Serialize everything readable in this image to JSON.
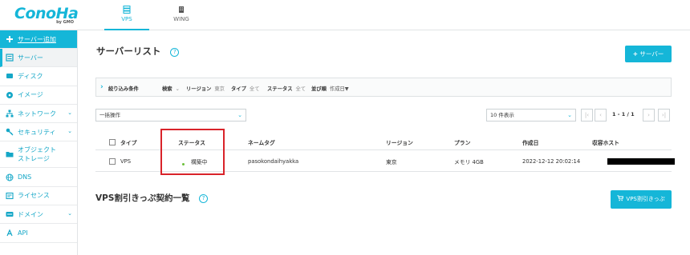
{
  "brand": {
    "logo_text": "ConoHa",
    "logo_sub": "by GMO",
    "accent_color": "#15b6d8"
  },
  "top_tabs": [
    {
      "label": "VPS",
      "icon": "server-stack-icon"
    },
    {
      "label": "WING",
      "icon": "building-icon"
    }
  ],
  "sidebar": {
    "items": [
      {
        "label": "サーバー追加",
        "icon": "plus-icon"
      },
      {
        "label": "サーバー",
        "icon": "server-icon"
      },
      {
        "label": "ディスク",
        "icon": "disk-icon"
      },
      {
        "label": "イメージ",
        "icon": "image-icon"
      },
      {
        "label": "ネットワーク",
        "icon": "network-icon"
      },
      {
        "label": "セキュリティ",
        "icon": "key-icon"
      },
      {
        "label": "オブジェクト",
        "label2": "ストレージ",
        "icon": "folder-icon"
      },
      {
        "label": "DNS",
        "icon": "globe-icon"
      },
      {
        "label": "ライセンス",
        "icon": "license-icon"
      },
      {
        "label": "ドメイン",
        "icon": "domain-icon"
      },
      {
        "label": "API",
        "icon": "api-icon"
      }
    ]
  },
  "main": {
    "title": "サーバーリスト",
    "help_glyph": "?",
    "add_server_label": "サーバー",
    "filter": {
      "toggle_label": "絞り込み条件",
      "search_label": "検索",
      "region_label": "リージョン",
      "region_value": "東京",
      "type_label": "タイプ",
      "type_value": "全て",
      "status_label": "ステータス",
      "status_value": "全て",
      "sort_label": "並び順",
      "sort_value": "作成日▼"
    },
    "bulk_action": "一括操作",
    "per_page": "10 件表示",
    "pagination": "1 - 1 / 1",
    "table": {
      "headers": [
        "タイプ",
        "ステータス",
        "ネームタグ",
        "リージョン",
        "プラン",
        "作成日",
        "収容ホスト"
      ],
      "rows": [
        {
          "type": "VPS",
          "status": "構築中",
          "name_tag": "pasokondaihyakka",
          "region": "東京",
          "plan": "メモリ 4GB",
          "created": "2022-12-12 20:02:14"
        }
      ]
    },
    "section2_title": "VPS割引きっぷ契約一覧",
    "coupon_button": "VPS割引きっぷ"
  }
}
